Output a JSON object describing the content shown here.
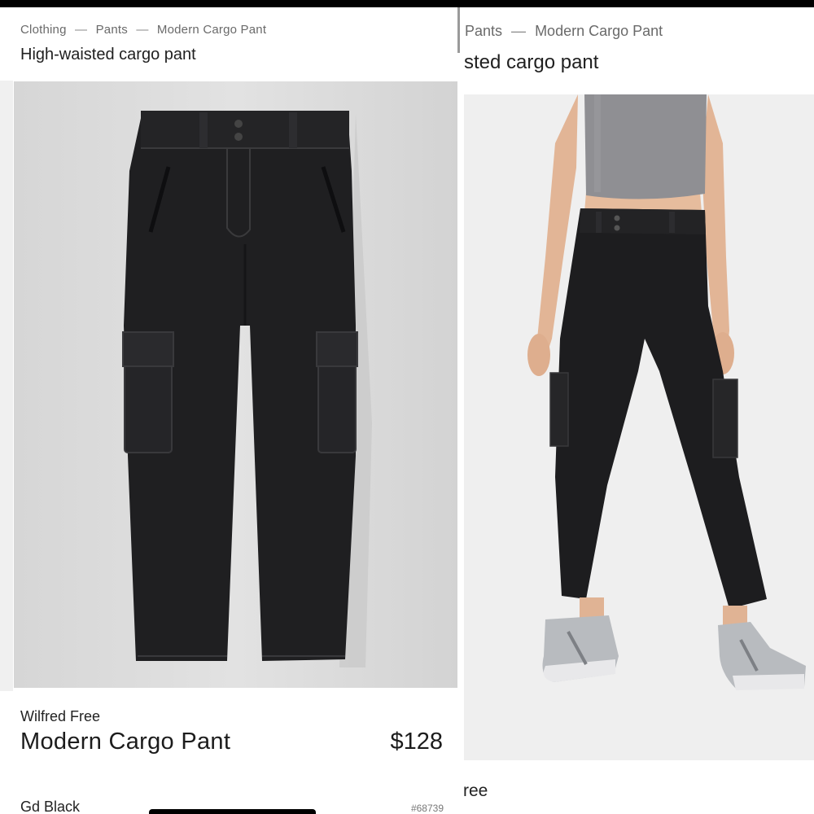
{
  "left_card": {
    "breadcrumb": [
      "Clothing",
      "Pants",
      "Modern Cargo Pant"
    ],
    "breadcrumb_separator": "—",
    "subtitle": "High-waisted cargo pant",
    "image_alt": "Black cargo pants product photo",
    "brand": "Wilfred Free",
    "product_name": "Modern Cargo Pant",
    "price": "$128",
    "color_name": "Gd Black",
    "sku": "#68739"
  },
  "right_card": {
    "breadcrumb_visible": [
      "Pants",
      "Modern Cargo Pant"
    ],
    "breadcrumb_separator": "—",
    "subtitle_visible": "sted cargo pant",
    "image_alt": "Model wearing black cargo pants",
    "brand_visible": "ree"
  },
  "colors": {
    "pants": "#1d1d1f",
    "background_left": "#d9d9d9",
    "background_right": "#efefef",
    "top": "#8d8d90",
    "skin": "#e3b89a",
    "sneaker": "#b9bcc0"
  }
}
